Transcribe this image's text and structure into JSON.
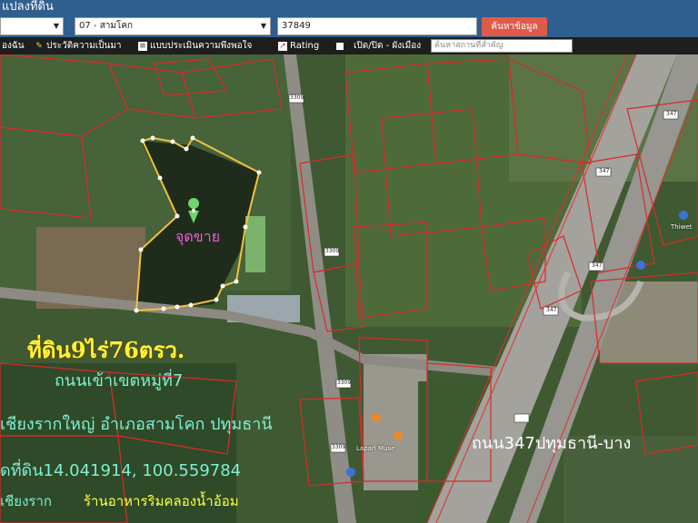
{
  "header": {
    "title": "แปลงที่ดิน",
    "province_select": "",
    "district_select": "07 - สามโคก",
    "parcel_input": "37849",
    "search_button": "ค้นหาข้อมูล"
  },
  "toolbar": {
    "items": [
      {
        "label": "องฉัน",
        "icon": "pin-icon"
      },
      {
        "label": "ประวัติความเป็นมา",
        "icon": "history-icon"
      },
      {
        "label": "แบบประเมินความพึงพอใจ",
        "icon": "document-icon"
      },
      {
        "label": "Rating",
        "icon": "chart-icon"
      },
      {
        "label": "เปิด/ปิด - ผังเมือง",
        "icon": "checkbox-icon"
      }
    ],
    "place_search_placeholder": "ค้นหาสถานที่สำคัญ"
  },
  "map": {
    "marker_label": "จุดขาย",
    "headline": "ที่ดิน9ไร่76ตรว.",
    "line2": "ถนนเข้าเขตหมู่ที่7",
    "line3": "เชียงรากใหญ่ อำเภอสามโคก ปทุมธานี",
    "line4": "ดที่ดิน14.041914, 100.559784",
    "line5": "เชียงราก",
    "line6": "ร้านอาหารริมคลองน้ำอ้อม",
    "road_label": "ถนน347ปทุมธานี-บาง",
    "road_shields": [
      "3309",
      "3309",
      "3309",
      "3309",
      "347",
      "347",
      "347",
      "347"
    ],
    "place_labels": [
      "Thiwet",
      "Laparl Muse"
    ],
    "colors": {
      "parcel_outline": "#d92a2a",
      "selected_parcel": "#ffd24a",
      "marker": "#6fd66a"
    }
  }
}
